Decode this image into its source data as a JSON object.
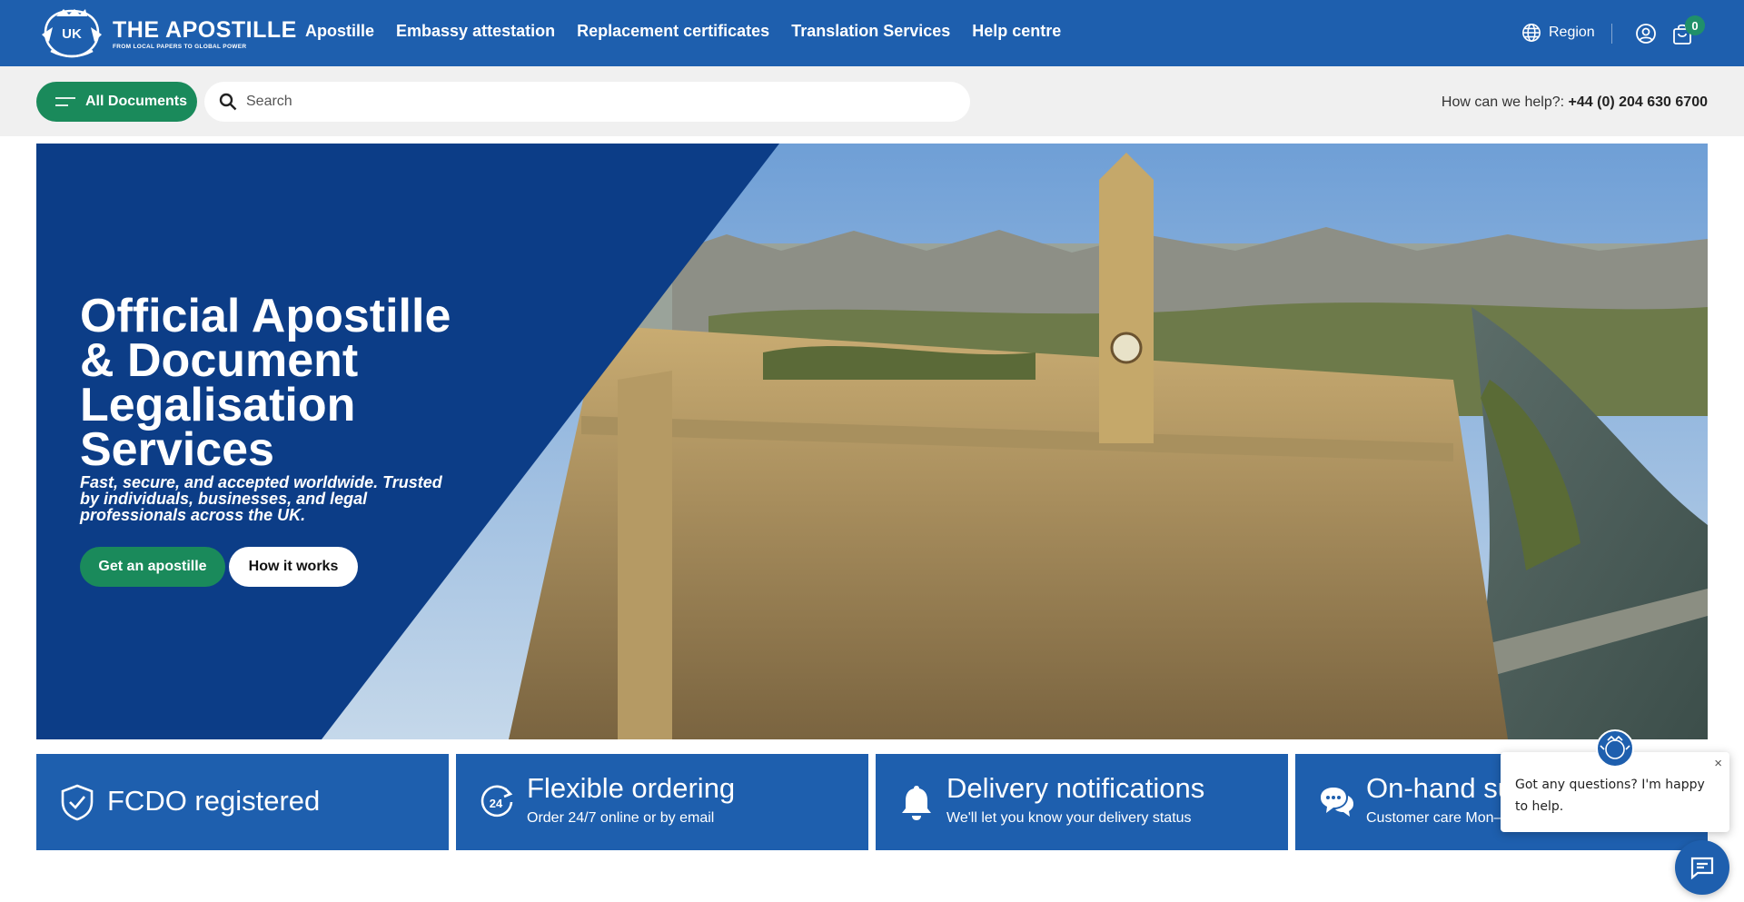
{
  "brand": {
    "name": "THE APOSTILLE",
    "tagline": "FROM LOCAL PAPERS TO GLOBAL POWER",
    "badge": "UK"
  },
  "nav": {
    "items": [
      {
        "label": "Apostille"
      },
      {
        "label": "Embassy attestation"
      },
      {
        "label": "Replacement certificates"
      },
      {
        "label": "Translation Services"
      },
      {
        "label": "Help centre"
      }
    ]
  },
  "header_actions": {
    "region_label": "Region",
    "region_icon": "globe-icon",
    "account_icon": "user-icon",
    "cart_icon": "shopping-bag-icon",
    "cart_count": "0"
  },
  "subbar": {
    "all_documents_label": "All Documents",
    "search_placeholder": "Search",
    "help_prefix": "How can we help?: ",
    "help_phone": "+44 (0) 204 630 6700"
  },
  "hero": {
    "title": "Official Apostille & Document Legalisation Services",
    "subtitle": "Fast, secure, and accepted worldwide. Trusted by individuals, businesses, and legal professionals across the UK.",
    "primary_cta": "Get an apostille",
    "secondary_cta": "How it works"
  },
  "features": [
    {
      "icon": "shield-check-icon",
      "title": "FCDO registered",
      "subtitle": ""
    },
    {
      "icon": "clock-24-icon",
      "title": "Flexible ordering",
      "subtitle": "Order 24/7 online or by email"
    },
    {
      "icon": "bell-icon",
      "title": "Delivery notifications",
      "subtitle": "We'll let you know your delivery status"
    },
    {
      "icon": "chat-bubbles-icon",
      "title": "On-hand sup",
      "subtitle": "Customer care Mon–"
    }
  ],
  "chat": {
    "message": "Got any questions? I'm happy to help.",
    "close_glyph": "×"
  },
  "colors": {
    "brand_blue": "#1e5fae",
    "hero_blue": "#0c3d87",
    "cta_green": "#1a8a5b"
  }
}
